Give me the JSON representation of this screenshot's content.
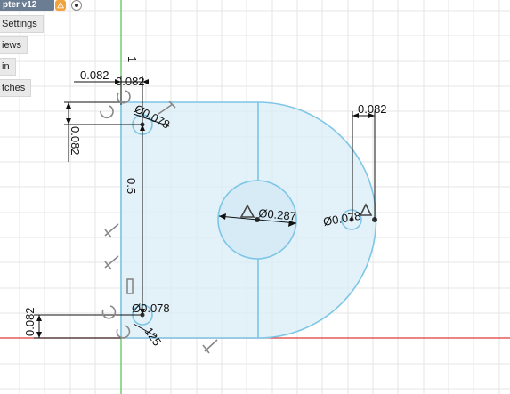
{
  "window": {
    "title": "pter v12"
  },
  "browser": {
    "items": [
      {
        "label": "Settings"
      },
      {
        "label": "iews"
      },
      {
        "label": "in"
      },
      {
        "label": "tches"
      }
    ]
  },
  "dimensions": {
    "top_left_horizontal": "0.082",
    "top_left_horizontal_2": "0.082",
    "top_left_vertical": "0.082",
    "top_circle_diameter": "Ø0.078",
    "left_edge_length": "0.5",
    "center_circle_diameter": "Ø0.287",
    "right_horizontal": "0.082",
    "right_circle_diameter": "Ø0.078",
    "bottom_left_vertical": "0.082",
    "bottom_circle_diameter": "Ø0.078",
    "bottom_small": "125",
    "axis_marker": "1"
  },
  "colors": {
    "sketch_line": "#7ec6e6",
    "profile_fill": "#d7ebf7",
    "grid": "#e6e6e6",
    "x_axis": "#e03a3a",
    "y_axis": "#4fc04f",
    "dimension": "#111111"
  }
}
